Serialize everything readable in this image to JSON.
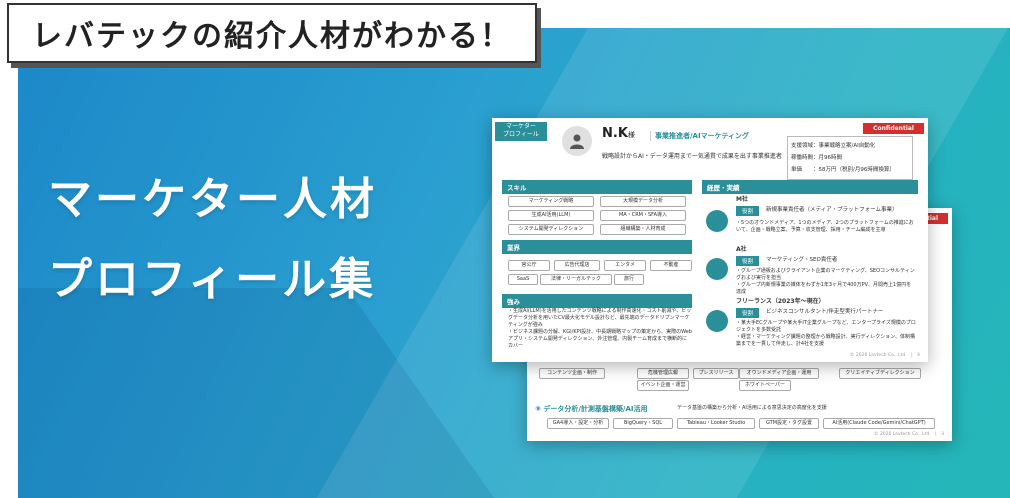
{
  "tag": {
    "label": "レバテックの紹介人材がわかる！"
  },
  "headline": {
    "line1": "マーケター人材",
    "line2": "プロフィール集"
  },
  "front": {
    "section_badge": "マーケター\nプロフィール",
    "confidential": "Confidential",
    "name": "N.K",
    "honorific": "様",
    "role": "事業推進者/AIマーケティング",
    "summary": "戦略設計からAI・データ運用まで一気通貫で成果を出す事業推進者",
    "info": [
      "支援領域：事業戦略立案/AI自動化",
      "稼働時間：月96時間",
      "単価　　：58万円（税別/月96時間換算）"
    ],
    "skills_title": "スキル",
    "skills": [
      "マーケティング戦略",
      "大規模データ分析",
      "生成AI活用(LLM)",
      "MA・CRM・SFA導入",
      "システム開発ディレクション",
      "組織構築・人材育成"
    ],
    "industry_title": "業界",
    "industries": [
      "官公庁",
      "広告代理店",
      "エンタメ",
      "不動産",
      "SaaS",
      "法律・リーガルテック",
      "旅行"
    ],
    "strength_title": "強み",
    "strengths": "・生成AI(LLM)を活用したコンテンツ戦略による制作高速化・コスト削減や、ビッグデータ分析を用いたCV最大化モデル設計など、最先端のデータドリブンマーケティングが強み\n・ビジネス課題の分解、KGI/KPI設計、中長期戦略マップの策定から、実際のWebアプリ・システム開発ディレクション、外注管理、内製チーム育成まで横断的にカバー",
    "career_title": "経歴・実績",
    "careers": [
      {
        "company": "M社",
        "badge": "役割",
        "role": "新規事業責任者（メディア・プラットフォーム事業）",
        "desc": "・5つのオウンドメディア、1つのメディア、2つのプラットフォームの推進において、企画・戦略立案、予算・収支管理、採用・チーム編成を主導"
      },
      {
        "company": "A社",
        "badge": "役割",
        "role": "マーケティング・SEO責任者",
        "desc": "・グループ通販およびクライアント企業のマーケティング、SEOコンサルティングおよび実行を担当\n・グループ内新規事業の媒体をわずか1年3ヶ月で400万PV、月間売上1億円を達成"
      },
      {
        "company": "フリーランス（2023年〜現在）",
        "badge": "役割",
        "role": "ビジネスコンサルタント/伴走型実行パートナー",
        "desc": "・某大手ECグループや某大手IT企業グループなど、エンタープライズ規模のプロジェクトを多数受託\n・経営・マーケティング課題の整理から戦略設計、実行ディレクション、体制構築までを一貫して伴走し、計4社を支援"
      }
    ],
    "footer": "© 2026 Levtech Co., Ltd.　|　4"
  },
  "back": {
    "confidential": "ential",
    "pills_row": [
      "コンテンツ企画・制作",
      "危機管理広報",
      "プレスリリース",
      "イベント企画・運営",
      "オウンドメディア企画・運用",
      "ホワイトペーパー",
      "クリエイティブディレクション"
    ],
    "ninth_title": "⑨ データ分析/計測基盤構築/AI活用",
    "ninth_desc": "データ基盤の構築から分析・AI活用による意思決定の高度化を支援",
    "ninth_pills": [
      "GA4導入・設定・分析",
      "BigQuery・SQL",
      "Tableau・Looker Studio",
      "GTM設定・タグ設置",
      "AI活用(Claude Code/Gemini/ChatGPT)"
    ],
    "footer": "© 2026 Levtech Co., Ltd.　|　3"
  }
}
